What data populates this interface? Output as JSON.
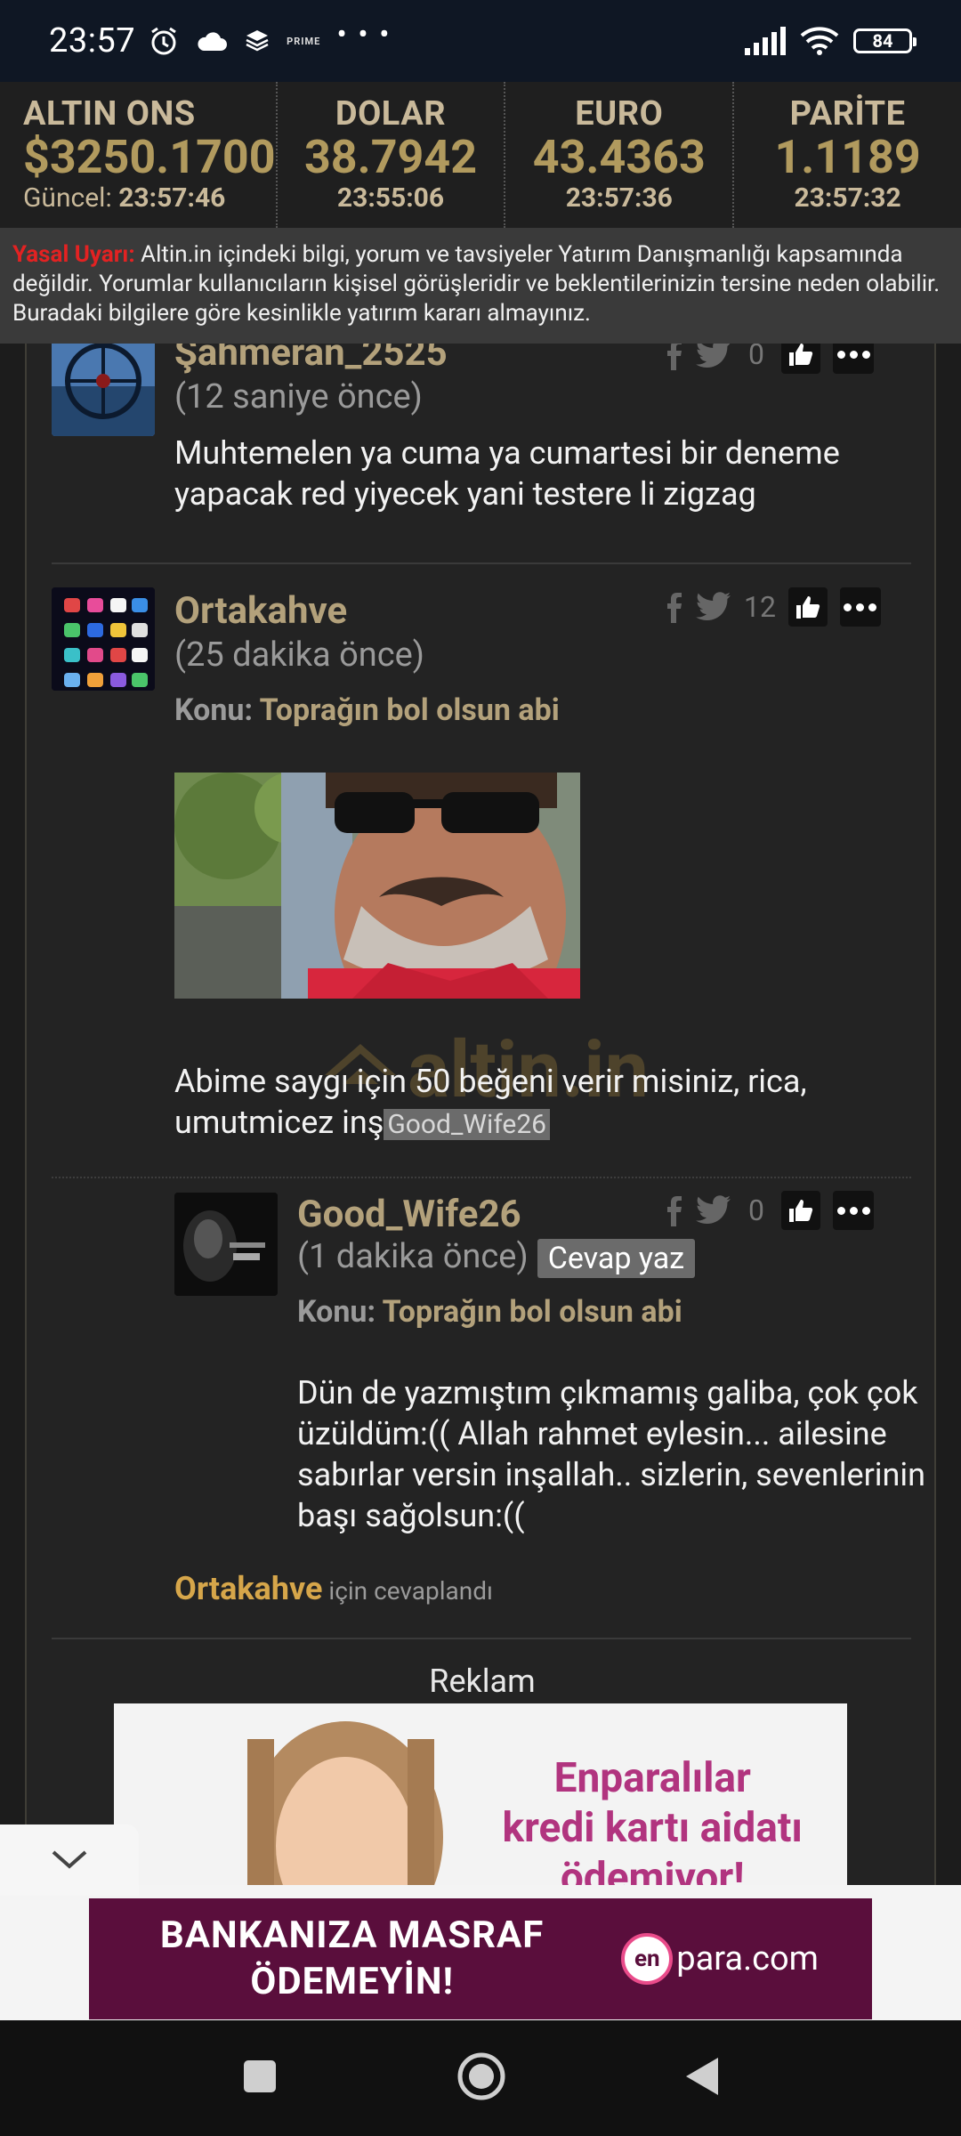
{
  "status_bar": {
    "time": "23:57",
    "prime_label": "PRIME",
    "more": "• • •",
    "battery": "84"
  },
  "ticker": [
    {
      "label": "ALTIN ONS",
      "value": "$3250.1700",
      "time_label": "Güncel:",
      "time": "23:57:46"
    },
    {
      "label": "DOLAR",
      "value": "38.7942",
      "time": "23:55:06"
    },
    {
      "label": "EURO",
      "value": "43.4363",
      "time": "23:57:36"
    },
    {
      "label": "PARİTE",
      "value": "1.1189",
      "time": "23:57:32"
    }
  ],
  "legal": {
    "warning_label": "Yasal Uyarı:",
    "text": "Altin.in içindeki bilgi, yorum ve tavsiyeler Yatırım Danışmanlığı kapsamında değildir. Yorumlar kullanıcıların kişisel görüşleridir ve beklentilerinizin tersine neden olabilir. Buradaki bilgilere göre kesinlikle yatırım kararı almayınız."
  },
  "comments": [
    {
      "username": "Şahmeran_2525",
      "time": "(12 saniye önce)",
      "likes": "0",
      "text": "Muhtemelen ya cuma ya cumartesi bir deneme yapacak red yiyecek yani testere li zigzag"
    },
    {
      "username": "Ortakahve",
      "time": "(25 dakika önce)",
      "likes": "12",
      "konu_label": "Konu:",
      "topic": "Toprağın bol olsun abi",
      "text": "Abime saygı için 50 beğeni verir misiniz, rica, umutmicez inş",
      "mention": "Good_Wife26"
    },
    {
      "username": "Good_Wife26",
      "time": "(1 dakika önce)",
      "reply_button": "Cevap yaz",
      "likes": "0",
      "konu_label": "Konu:",
      "topic": "Toprağın bol olsun abi",
      "text": "Dün de yazmıştım çıkmamış galiba, çok çok üzüldüm:(( Allah rahmet eylesin... ailesine sabırlar versin inşallah.. sizlerin, sevenlerinin başı sağolsun:((",
      "answered_who": "Ortakahve",
      "answered_suffix": "için cevaplandı"
    }
  ],
  "watermark": "altin.in",
  "reklam": {
    "label": "Reklam",
    "ad_line1": "Enparalılar",
    "ad_line2": "kredi kartı aidatı",
    "ad_line3": "ödemiyor!"
  },
  "bottom_ad": {
    "line1": "BANKANIZA MASRAF",
    "line2": "ÖDEMEYİN!",
    "brand_circle": "en",
    "brand_text": "para.com"
  }
}
